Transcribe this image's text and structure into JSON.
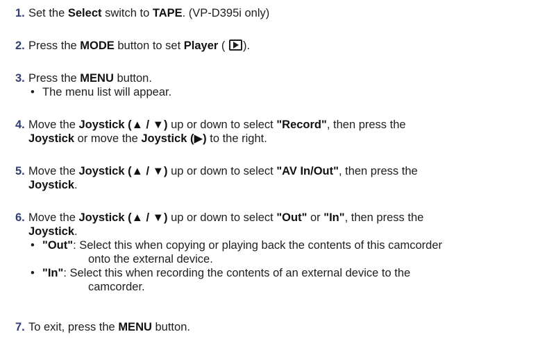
{
  "steps": [
    {
      "num": "1.",
      "pre": "Set the ",
      "b1": "Select",
      "mid": " switch to ",
      "b2": "TAPE",
      "post": ". (VP-D395i only)"
    },
    {
      "num": "2.",
      "pre": "Press the ",
      "b1": "MODE",
      "mid": " button to set ",
      "b2": "Player",
      "post1": " (",
      "icon": "player-mode-icon",
      "post2": ")."
    },
    {
      "num": "3.",
      "pre": "Press the ",
      "b1": "MENU",
      "post": " button.",
      "bullet": "•",
      "sub": "The menu list will appear."
    },
    {
      "num": "4.",
      "p1": "Move the ",
      "b1": "Joystick (▲ / ▼)",
      "p2": " up or down to select ",
      "b2": "\"Record\"",
      "p3": ", then press the",
      "b3": "Joystick",
      "p4": " or move the ",
      "b4": "Joystick (▶)",
      "p5": " to the right."
    },
    {
      "num": "5.",
      "p1": "Move the ",
      "b1": "Joystick (▲ / ▼)",
      "p2": " up or down to select ",
      "b2": "\"AV In/Out\"",
      "p3": ", then press the",
      "b3": "Joystick",
      "p4": "."
    },
    {
      "num": "6.",
      "p1": "Move the ",
      "b1": "Joystick (▲ / ▼)",
      "p2": " up or down to select ",
      "b2": "\"Out\"",
      "p3": " or ",
      "b3": "\"In\"",
      "p4": ", then press the",
      "b4": "Joystick",
      "p5": ".",
      "subs": [
        {
          "bullet": "•",
          "b": "\"Out\"",
          "t1": ": Select this when copying or playing back the contents of this camcorder",
          "t2": "onto the external device."
        },
        {
          "bullet": "•",
          "b": "\"In\"",
          "t1": ": Select this when recording the contents of an external device to the",
          "t2": "camcorder."
        }
      ]
    },
    {
      "num": "7.",
      "pre": "To exit, press the ",
      "b1": "MENU",
      "post": " button."
    }
  ]
}
